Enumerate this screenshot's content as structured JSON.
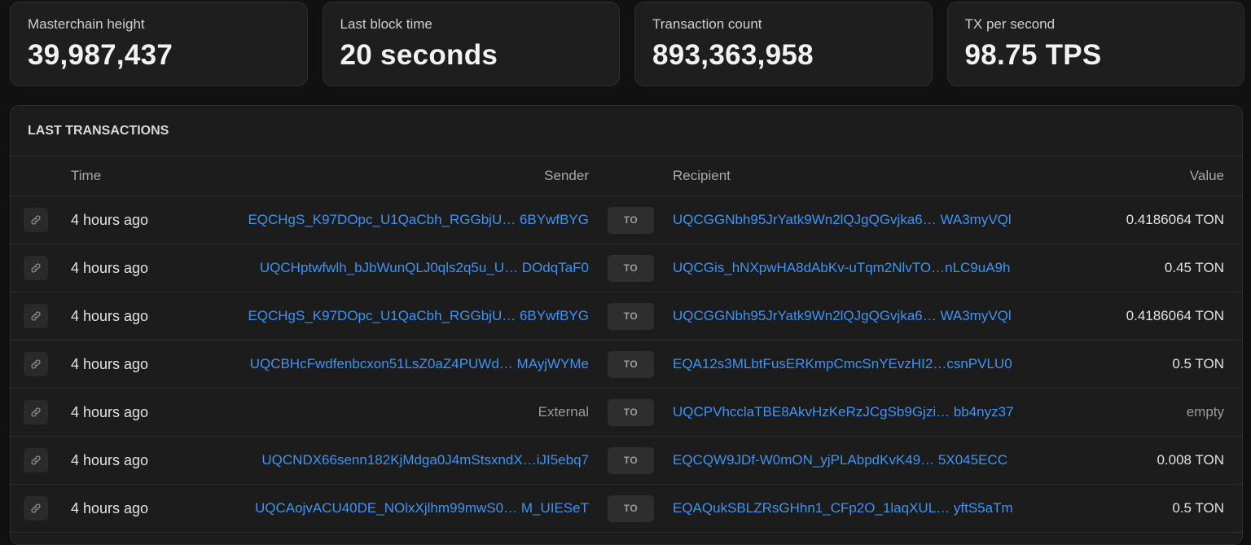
{
  "stats": [
    {
      "label": "Masterchain height",
      "value": "39,987,437"
    },
    {
      "label": "Last block time",
      "value": "20 seconds"
    },
    {
      "label": "Transaction count",
      "value": "893,363,958"
    },
    {
      "label": "TX per second",
      "value": "98.75 TPS"
    }
  ],
  "transactions": {
    "title": "LAST TRANSACTIONS",
    "columns": {
      "time": "Time",
      "sender": "Sender",
      "recipient": "Recipient",
      "value": "Value"
    },
    "to_label": "TO",
    "rows": [
      {
        "time": "4 hours ago",
        "sender": "EQCHgS_K97DOpc_U1QaCbh_RGGbjU… 6BYwfBYG",
        "recipient": "UQCGGNbh95JrYatk9Wn2lQJgQGvjka6… WA3myVQl",
        "value": "0.4186064 TON"
      },
      {
        "time": "4 hours ago",
        "sender": "UQCHptwfwlh_bJbWunQLJ0qls2q5u_U… DOdqTaF0",
        "recipient": "UQCGis_hNXpwHA8dAbKv-uTqm2NlvTO…nLC9uA9h",
        "value": "0.45 TON"
      },
      {
        "time": "4 hours ago",
        "sender": "EQCHgS_K97DOpc_U1QaCbh_RGGbjU… 6BYwfBYG",
        "recipient": "UQCGGNbh95JrYatk9Wn2lQJgQGvjka6… WA3myVQl",
        "value": "0.4186064 TON"
      },
      {
        "time": "4 hours ago",
        "sender": "UQCBHcFwdfenbcxon51LsZ0aZ4PUWd… MAyjWYMe",
        "recipient": "EQA12s3MLbtFusERKmpCmcSnYEvzHI2…csnPVLU0",
        "value": "0.5 TON"
      },
      {
        "time": "4 hours ago",
        "sender": "External",
        "recipient": "UQCPVhcclaTBE8AkvHzKeRzJCgSb9Gjzi… bb4nyz37",
        "value": "empty"
      },
      {
        "time": "4 hours ago",
        "sender": "UQCNDX66senn182KjMdga0J4mStsxndX…iJI5ebq7",
        "recipient": "EQCQW9JDf-W0mON_yjPLAbpdKvK49… 5X045ECC",
        "value": "0.008 TON"
      },
      {
        "time": "4 hours ago",
        "sender": "UQCAojvACU40DE_NOlxXjlhm99mwS0… M_UIESeT",
        "recipient": "EQAQukSBLZRsGHhn1_CFp2O_1laqXUL… yftS5aTm",
        "value": "0.5 TON"
      }
    ]
  },
  "colors": {
    "background": "#111111",
    "card": "#1e1e1e",
    "address_link": "#3f93f2",
    "muted_text": "#9a9a9a"
  },
  "icons": {
    "row_link": "link-icon"
  }
}
